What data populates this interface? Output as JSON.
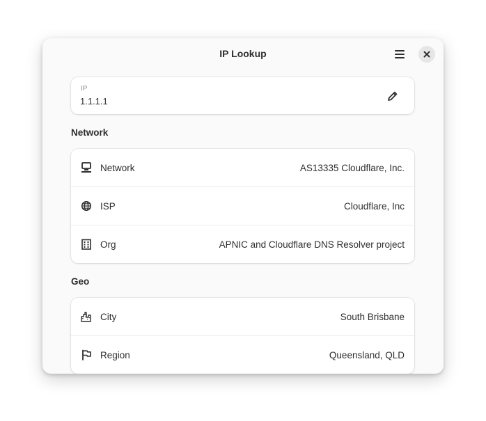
{
  "window": {
    "title": "IP Lookup"
  },
  "headerbar": {
    "menu_icon": "hamburger-menu-icon",
    "close_icon": "close-icon"
  },
  "ip_entry": {
    "label": "IP",
    "value": "1.1.1.1",
    "edit_icon": "pencil-icon"
  },
  "network": {
    "section_title": "Network",
    "rows": [
      {
        "icon": "network-computer-icon",
        "label": "Network",
        "value": "AS13335 Cloudflare, Inc."
      },
      {
        "icon": "globe-icon",
        "label": "ISP",
        "value": "Cloudflare, Inc"
      },
      {
        "icon": "building-icon",
        "label": "Org",
        "value": "APNIC and Cloudflare DNS Resolver project"
      }
    ]
  },
  "geo": {
    "section_title": "Geo",
    "rows": [
      {
        "icon": "city-icon",
        "label": "City",
        "value": "South Brisbane"
      },
      {
        "icon": "flag-icon",
        "label": "Region",
        "value": "Queensland, QLD"
      }
    ]
  }
}
